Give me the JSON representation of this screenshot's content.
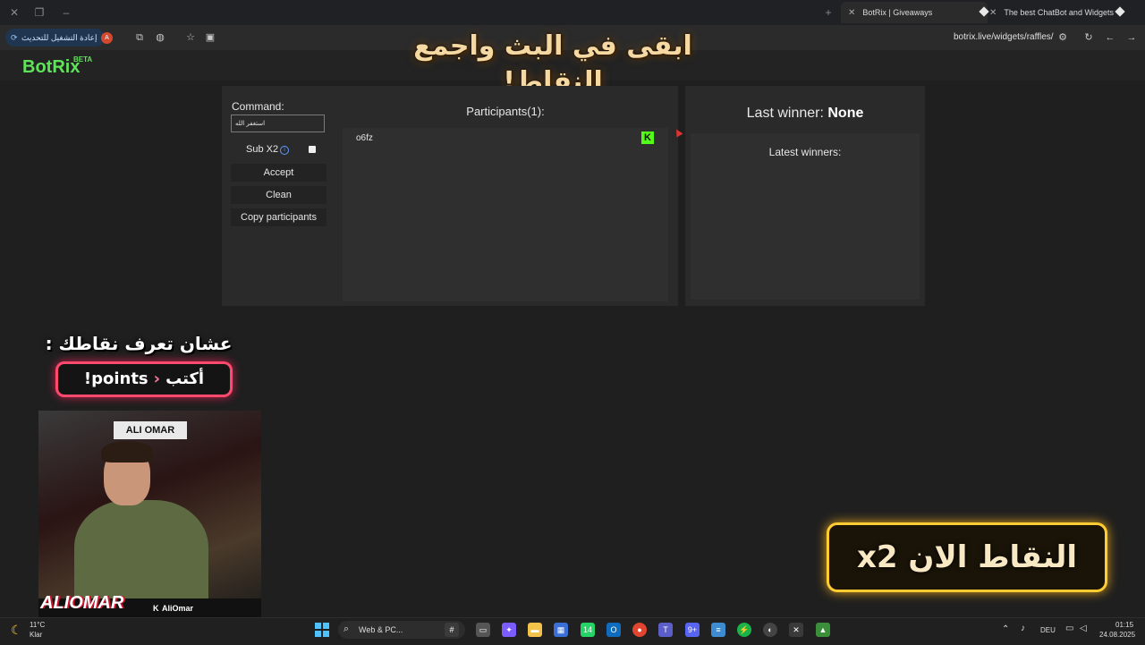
{
  "browser": {
    "tabs": [
      {
        "title": "BotRix | Giveaways"
      },
      {
        "title": "The best ChatBot and Widgets"
      }
    ],
    "update_label": "إعادة التشغيل للتحديث",
    "profile_initial": "A",
    "url": "botrix.live/widgets/raffles/"
  },
  "overlay": {
    "top_banner": "ابقى في البث واجمع النقاط!",
    "points_hint": "عشان تعرف نقاطك :",
    "points_write": "أكتب",
    "points_command": "!points",
    "x2_banner": "النقاط الان x2",
    "cam_sign": "ALI OMAR",
    "cam_logo": "ALIOMAR",
    "cam_platform": "K",
    "cam_channel": "AliOmar"
  },
  "app": {
    "logo": "BotRix",
    "beta": "BETA"
  },
  "raffle": {
    "command_label": "Command:",
    "command_value": "استغفر الله",
    "subx2_label": "Sub X2",
    "buttons": {
      "accept": "Accept",
      "clean": "Clean",
      "copy": "Copy participants"
    },
    "participants_title": "Participants(1):",
    "participants": [
      "o6fz"
    ],
    "last_winner_label": "Last winner:",
    "last_winner_value": "None",
    "latest_winners_label": "Latest winners:"
  },
  "taskbar": {
    "weather_temp": "11°C",
    "weather_desc": "Klar",
    "search_placeholder": "Web & PC...",
    "lang": "DEU",
    "time": "01:15",
    "date": "24.08.2025",
    "whatsapp_badge": "14",
    "discord_badge": "9+"
  },
  "colors": {
    "kick_green": "#53fc18",
    "botrix_green": "#5fe35a",
    "panel": "#2a2a2a"
  }
}
